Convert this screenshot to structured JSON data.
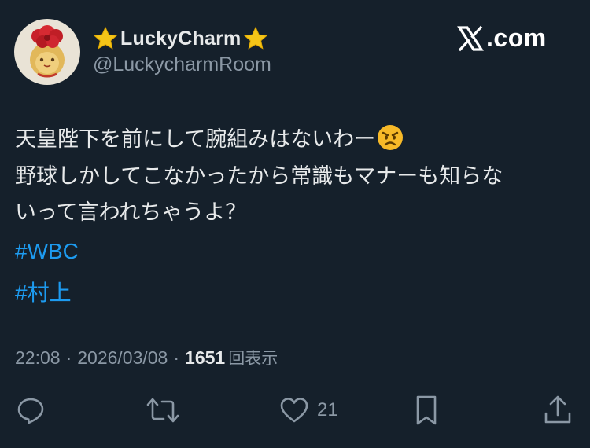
{
  "header": {
    "display_name": "LuckyCharm",
    "handle": "@LuckycharmRoom",
    "brand": "X.com",
    "brand_suffix": ".com",
    "name_decoration_icon": "star-emoji",
    "avatar_icon": "lucky-cat-with-roses"
  },
  "tweet": {
    "lines": [
      "天皇陛下を前にして腕組みはないわー",
      "野球しかしてこなかったから常識もマナーも知らな",
      "いって言われちゃうよ？"
    ],
    "emoji": "angry-face-emoji",
    "hashtags": [
      "#WBC",
      "#村上"
    ]
  },
  "meta": {
    "time": "22:08",
    "separator": "·",
    "date": "2026/03/08",
    "views_count": "1651",
    "views_label": "回表示"
  },
  "actions": {
    "reply_icon": "reply-icon",
    "retweet_icon": "retweet-icon",
    "like_icon": "heart-icon",
    "like_count": "21",
    "bookmark_icon": "bookmark-icon",
    "share_icon": "share-icon"
  },
  "colors": {
    "background": "#15202b",
    "text": "#e7e9ea",
    "secondary": "#8b98a5",
    "link": "#1d9bf0"
  }
}
